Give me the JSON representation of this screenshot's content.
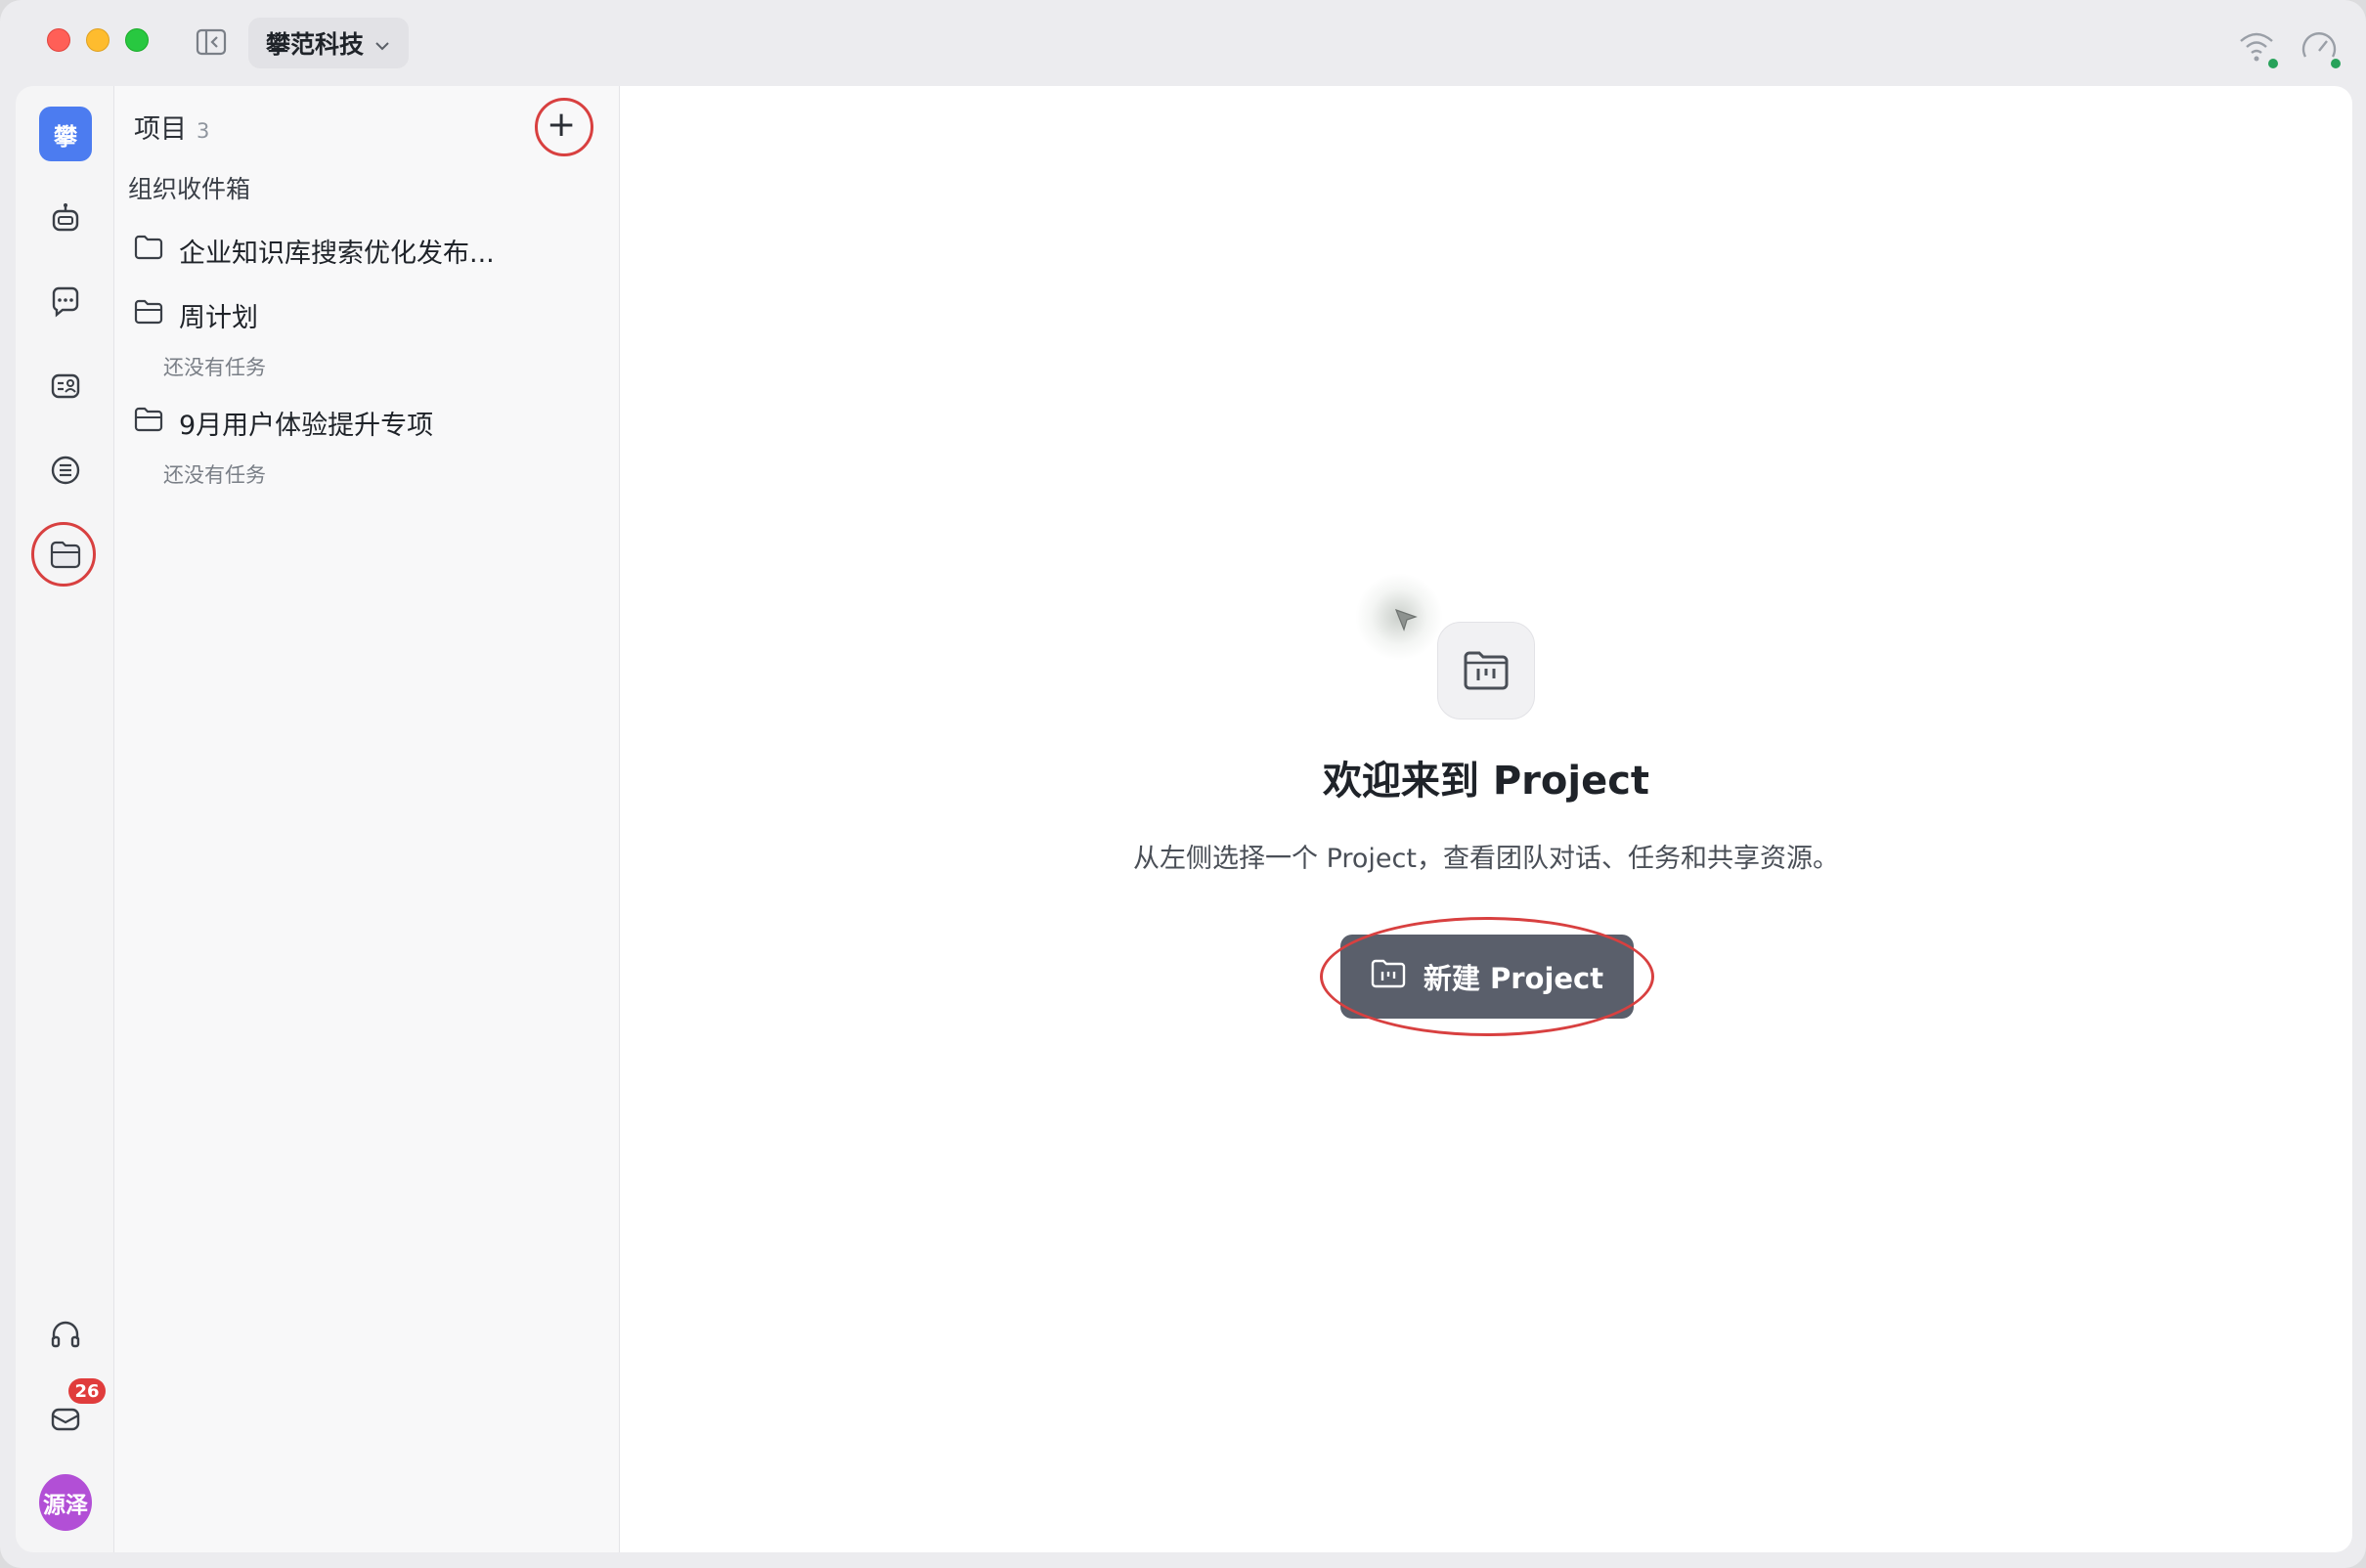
{
  "titlebar": {
    "org_name": "攀范科技"
  },
  "rail": {
    "org_avatar_text": "攀",
    "mail_badge": "26",
    "user_avatar_text": "源泽"
  },
  "panel": {
    "title": "项目",
    "count": "3",
    "add_label": "+",
    "inbox": "组织收件箱",
    "projects": [
      {
        "name": "企业知识库搜索优化发布..."
      },
      {
        "name": "周计划",
        "note": "还没有任务"
      },
      {
        "name": "9月用户体验提升专项",
        "note": "还没有任务"
      }
    ]
  },
  "main": {
    "welcome_title": "欢迎来到 Project",
    "welcome_subtitle": "从左侧选择一个 Project，查看团队对话、任务和共享资源。",
    "new_button_label": "新建 Project"
  },
  "colors": {
    "accent_blue": "#4c7cf0",
    "button_gray": "#5a5f6b",
    "annotation_red": "#d84040",
    "badge_red": "#e03c3c",
    "avatar_purple": "#b24fd6",
    "status_green": "#27a25a"
  },
  "icons": {
    "sidebar_toggle": "sidebar-toggle-icon",
    "wifi": "wifi-icon",
    "speed": "gauge-icon",
    "agent": "robot-icon",
    "chat": "chat-bubble-icon",
    "contacts": "contact-card-icon",
    "docs": "list-doc-icon",
    "projects": "folder-icon",
    "support": "headphones-icon",
    "mail": "mail-icon"
  }
}
